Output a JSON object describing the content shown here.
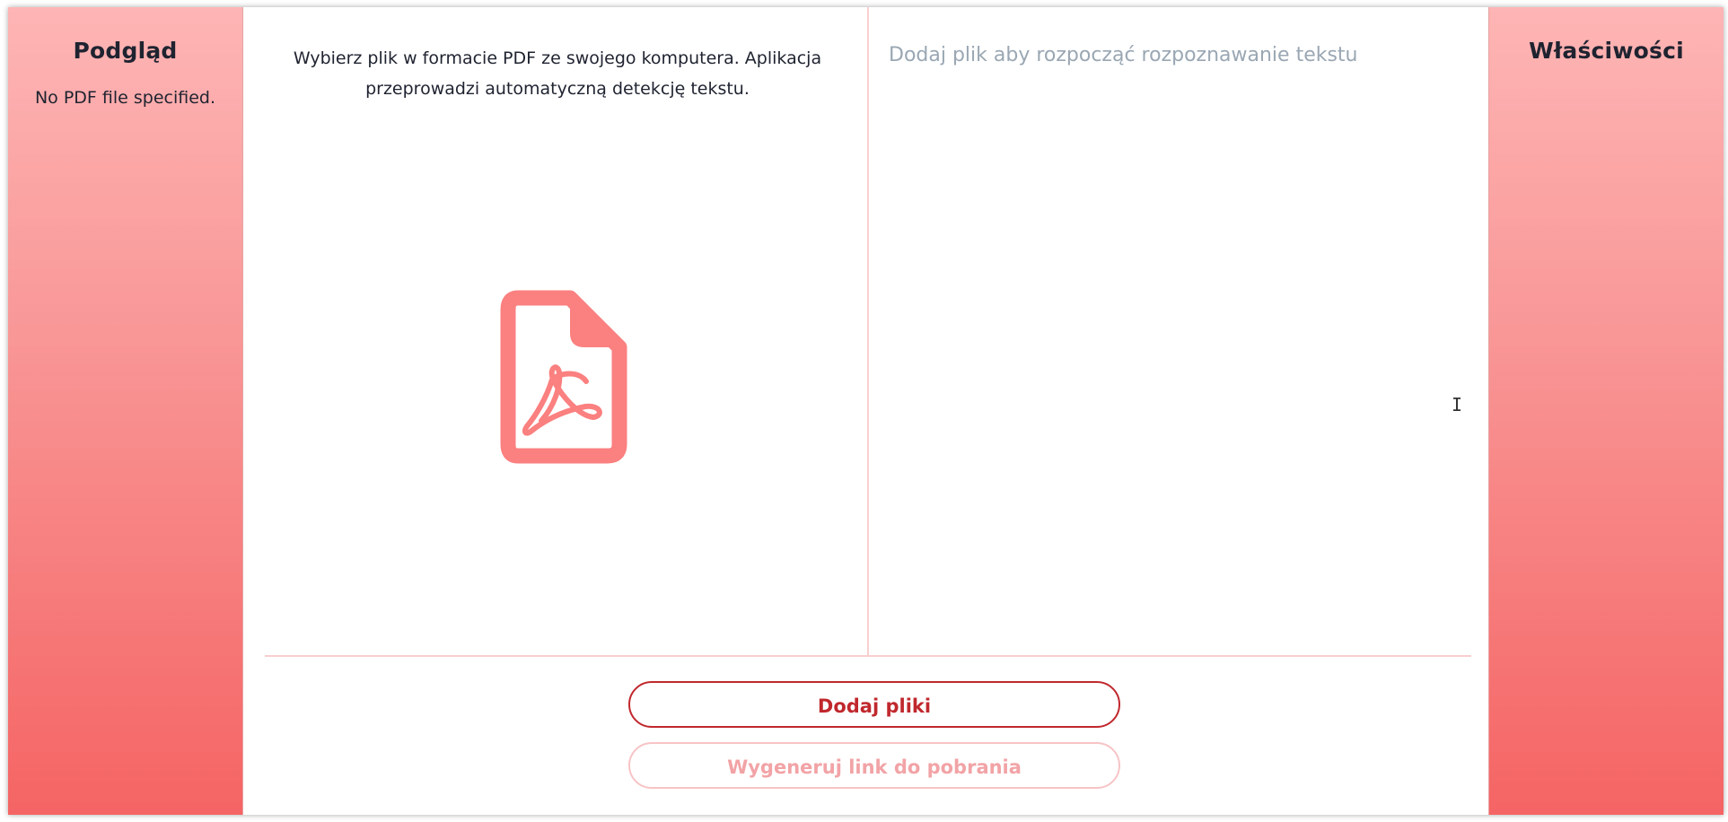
{
  "left_panel": {
    "title": "Podgląd",
    "note": "No PDF file specified."
  },
  "right_panel": {
    "title": "Właściwości"
  },
  "upload": {
    "intro": "Wybierz plik w formacie PDF ze swojego komputera. Aplikacja przeprowadzi automatyczną detekcję tekstu.",
    "icon": "pdf-file-icon"
  },
  "text_area": {
    "placeholder": "Dodaj plik aby rozpocząć rozpoznawanie tekstu"
  },
  "actions": {
    "add_files_label": "Dodaj pliki",
    "generate_link_label": "Wygeneruj link do pobrania"
  },
  "colors": {
    "accent": "#c0282d",
    "icon": "#fb8080",
    "gradient_top": "#feb5b5",
    "gradient_bottom": "#f56464",
    "placeholder": "#9aa7b3"
  }
}
